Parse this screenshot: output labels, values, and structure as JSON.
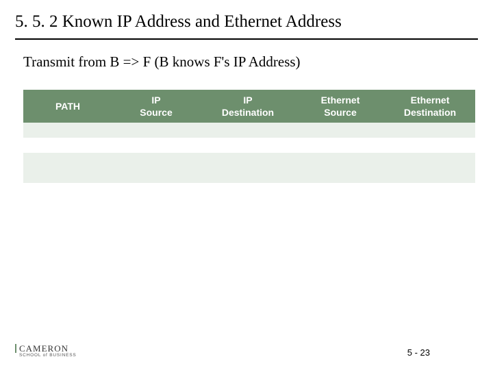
{
  "title": "5. 5. 2  Known IP Address and Ethernet Address",
  "subtitle": "Transmit from B => F (B knows F's IP Address)",
  "table": {
    "headers": [
      "PATH",
      "IP\nSource",
      "IP\nDestination",
      "Ethernet\nSource",
      "Ethernet\nDestination"
    ],
    "rows": [
      [
        "",
        "",
        "",
        "",
        ""
      ],
      [
        "",
        "",
        "",
        "",
        ""
      ],
      [
        "",
        "",
        "",
        "",
        ""
      ],
      [
        "",
        "",
        "",
        "",
        ""
      ]
    ]
  },
  "logo": {
    "main": "CAMERON",
    "sub": "SCHOOL of BUSINESS"
  },
  "pageNumber": "5 - 23"
}
